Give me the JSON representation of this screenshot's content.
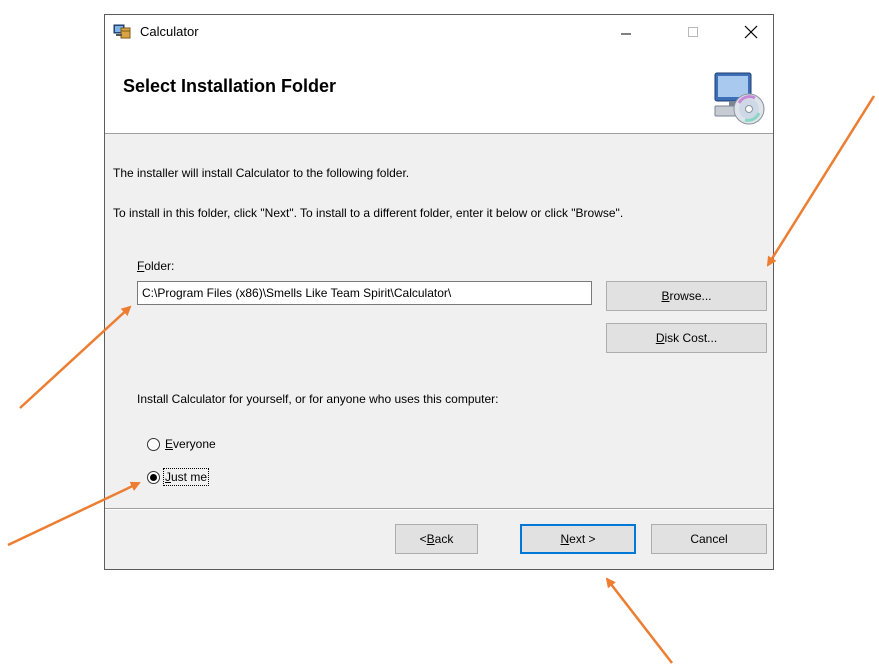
{
  "window": {
    "title": "Calculator",
    "controls": [
      "minimize-icon",
      "maximize-icon",
      "close-icon"
    ]
  },
  "header": {
    "title": "Select Installation Folder",
    "icon": "computer-cd-icon"
  },
  "body": {
    "line1": "The installer will install Calculator to the following folder.",
    "line2": "To install in this folder, click \"Next\". To install to a different folder, enter it below or click \"Browse\"."
  },
  "folder": {
    "label_mnemonic": "F",
    "label_rest": "older:",
    "value": "C:\\Program Files (x86)\\Smells Like Team Spirit\\Calculator\\"
  },
  "buttons": {
    "browse": {
      "mnemonic": "B",
      "rest": "rowse..."
    },
    "disk_cost": {
      "mnemonic": "D",
      "rest": "isk Cost..."
    },
    "back": {
      "prefix": "< ",
      "mnemonic": "B",
      "rest": "ack"
    },
    "next": {
      "mnemonic": "N",
      "rest": "ext >"
    },
    "cancel": "Cancel"
  },
  "install_for": {
    "question": "Install Calculator for yourself, or for anyone who uses this computer:",
    "options": [
      {
        "mnemonic": "E",
        "rest": "veryone",
        "selected": false
      },
      {
        "mnemonic": "J",
        "rest": "ust me",
        "selected": true
      }
    ]
  },
  "colors": {
    "dialog_bg": "#f0f0f0",
    "annotation_arrow": "#ed7d31",
    "default_button_border": "#0078d7"
  }
}
